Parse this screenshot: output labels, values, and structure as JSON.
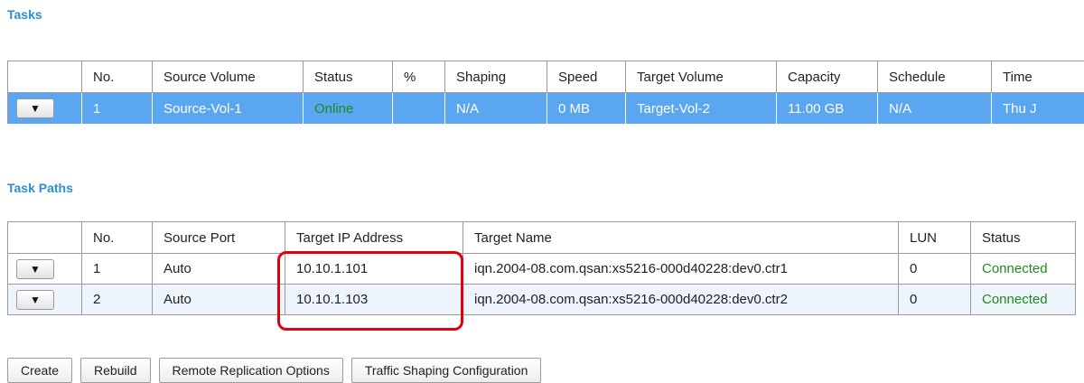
{
  "tasks": {
    "title": "Tasks",
    "columns": [
      "",
      "No.",
      "Source Volume",
      "Status",
      "%",
      "Shaping",
      "Speed",
      "Target Volume",
      "Capacity",
      "Schedule",
      "Time"
    ],
    "rows": [
      {
        "menu_icon": "▼",
        "no": "1",
        "source_volume": "Source-Vol-1",
        "status": "Online",
        "percent": "",
        "shaping": "N/A",
        "speed": "0 MB",
        "target_volume": "Target-Vol-2",
        "capacity": "11.00 GB",
        "schedule": "N/A",
        "time": "Thu J"
      }
    ]
  },
  "task_paths": {
    "title": "Task Paths",
    "columns": [
      "",
      "No.",
      "Source Port",
      "Target IP Address",
      "Target Name",
      "LUN",
      "Status"
    ],
    "rows": [
      {
        "menu_icon": "▼",
        "no": "1",
        "source_port": "Auto",
        "target_ip": "10.10.1.101",
        "target_name": "iqn.2004-08.com.qsan:xs5216-000d40228:dev0.ctr1",
        "lun": "0",
        "status": "Connected"
      },
      {
        "menu_icon": "▼",
        "no": "2",
        "source_port": "Auto",
        "target_ip": "10.10.1.103",
        "target_name": "iqn.2004-08.com.qsan:xs5216-000d40228:dev0.ctr2",
        "lun": "0",
        "status": "Connected"
      }
    ]
  },
  "toolbar": {
    "create": "Create",
    "rebuild": "Rebuild",
    "remote_replication_options": "Remote Replication Options",
    "traffic_shaping_configuration": "Traffic Shaping Configuration"
  },
  "colors": {
    "section_title": "#2a8fd6",
    "selected_row": "#5ba6f0",
    "status_green": "#1f8a1f",
    "highlight": "#e0000f"
  }
}
